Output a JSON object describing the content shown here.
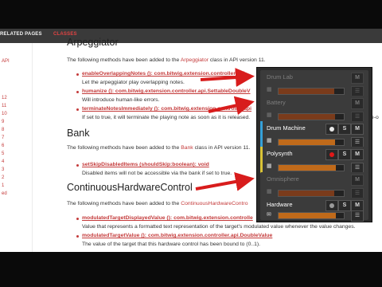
{
  "topnav": {
    "related_pages": "RELATED PAGES",
    "classes": "CLASSES"
  },
  "sidebar": {
    "items": [
      "API",
      "12",
      "11",
      "10",
      "9",
      "8",
      "7",
      "6",
      "5",
      "4",
      "3",
      "2",
      "1",
      "ed"
    ]
  },
  "content": {
    "partial_heading": "Arpeggiator",
    "arp_intro_pre": "The following methods have been added to the ",
    "arp_intro_class": "Arpeggiator",
    "arp_intro_post": " class in API version 11.",
    "arp_methods": [
      {
        "sig": "enableOverlappingNotes (): com.bitwig.extension.controller.api",
        "desc": "Let the arpeggiator play overlapping notes."
      },
      {
        "sig": "humanize (): com.bitwig.extension.controller.api.SettableDoubleV",
        "desc": "Will introduce human-like errors."
      },
      {
        "sig": "terminateNotesImmediately (): com.bitwig.extension.controller.api",
        "desc": "If set to true, it will terminate the playing note as soon as it is released."
      }
    ],
    "arp_overflow": "e-o",
    "bank_heading": "Bank",
    "bank_intro_pre": "The following methods have been added to the ",
    "bank_intro_class": "Bank",
    "bank_intro_post": " class in API version 11.",
    "bank_methods": [
      {
        "sig": "setSkipDisabledItems (shouldSkip:boolean): void",
        "desc": "Disabled items will not be accessible via the bank if set to true."
      }
    ],
    "chc_heading": "ContinuousHardwareControl",
    "chc_intro_pre": "The following methods have been added to the ",
    "chc_intro_class": "ContinuousHardwareContro",
    "chc_methods": [
      {
        "sig": "modulatedTargetDisplayedValue (): com.bitwig.extension.controlle",
        "desc": "Value that represents a formatted text representation of the target's modulated value whenever the value changes."
      },
      {
        "sig": "modulatedTargetValue (): com.bitwig.extension.controller.api.DoubleValue",
        "desc": "The value of the target that this hardware control has been bound to (0..1)."
      }
    ]
  },
  "tracks": [
    {
      "name": "Drum Lab",
      "dim": true,
      "buttons": [
        "M"
      ],
      "level": 0.85,
      "stripe": ""
    },
    {
      "name": "Battery",
      "dim": true,
      "buttons": [
        "M"
      ],
      "level": 0.86,
      "stripe": ""
    },
    {
      "name": "Drum Machine",
      "dim": false,
      "buttons": [
        "dot",
        "S",
        "M"
      ],
      "dot_color": "#e8e8e8",
      "level": 0.87,
      "stripe": "#35a1d9"
    },
    {
      "name": "Polysynth",
      "dim": false,
      "buttons": [
        "dot",
        "S",
        "M"
      ],
      "dot_color": "#e01818",
      "level": 0.88,
      "stripe": "#d9c337"
    },
    {
      "name": "Omnisphere",
      "dim": true,
      "buttons": [
        "M"
      ],
      "level": 0.85,
      "stripe": ""
    },
    {
      "name": "Hardware",
      "dim": false,
      "buttons": [
        "dot",
        "S",
        "M"
      ],
      "dot_color": "#9a9a9a",
      "level": 0.88,
      "stripe": ""
    }
  ],
  "arrow_color": "#d81c1c"
}
